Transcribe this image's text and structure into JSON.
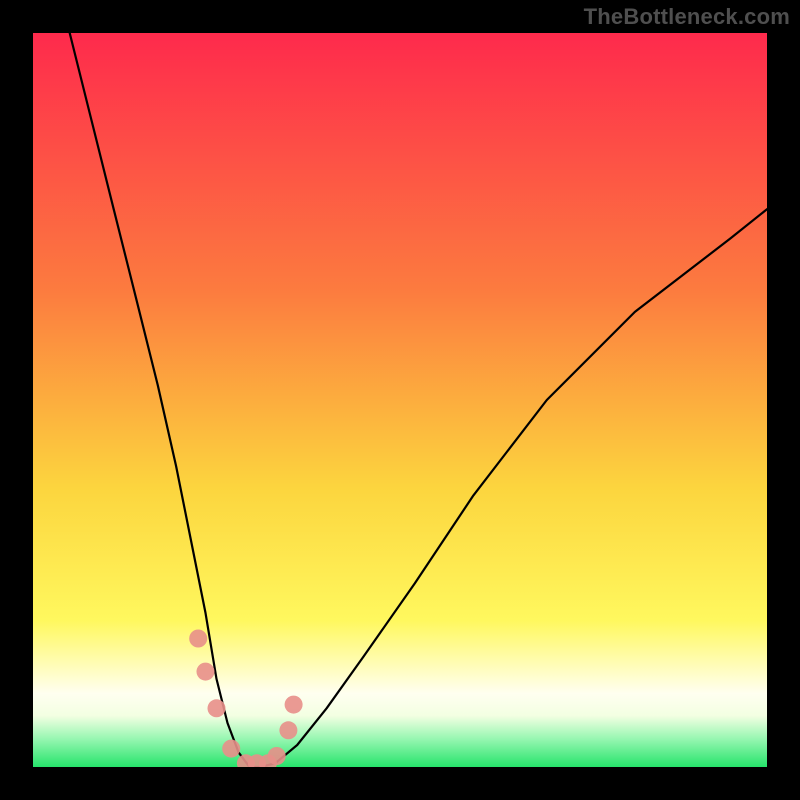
{
  "watermark": "TheBottleneck.com",
  "colors": {
    "frame": "#000000",
    "curve": "#000000",
    "marker_fill": "#e88f89",
    "gradient_top": "#fe2a4c",
    "gradient_mid": "#f9c040",
    "gradient_yellow": "#fff85e",
    "gradient_pale": "#fffff0",
    "gradient_green": "#26e46b"
  },
  "chart_data": {
    "type": "line",
    "title": "",
    "xlabel": "",
    "ylabel": "",
    "xlim": [
      0,
      100
    ],
    "ylim": [
      0,
      100
    ],
    "series": [
      {
        "name": "bottleneck-curve",
        "x": [
          5,
          8,
          11,
          14,
          17,
          19.5,
          21.5,
          23.5,
          25,
          26.5,
          28,
          29.5,
          31,
          33,
          36,
          40,
          45,
          52,
          60,
          70,
          82,
          95,
          100
        ],
        "values": [
          100,
          88,
          76,
          64,
          52,
          41,
          31,
          21,
          12,
          6,
          2,
          0,
          0,
          0.5,
          3,
          8,
          15,
          25,
          37,
          50,
          62,
          72,
          76
        ]
      }
    ],
    "markers": {
      "name": "highlighted-points",
      "x": [
        22.5,
        23.5,
        25.0,
        27.0,
        29.0,
        30.5,
        32.0,
        33.2,
        34.8,
        35.5
      ],
      "values": [
        17.5,
        13.0,
        8.0,
        2.5,
        0.5,
        0.5,
        0.5,
        1.5,
        5.0,
        8.5
      ]
    }
  }
}
